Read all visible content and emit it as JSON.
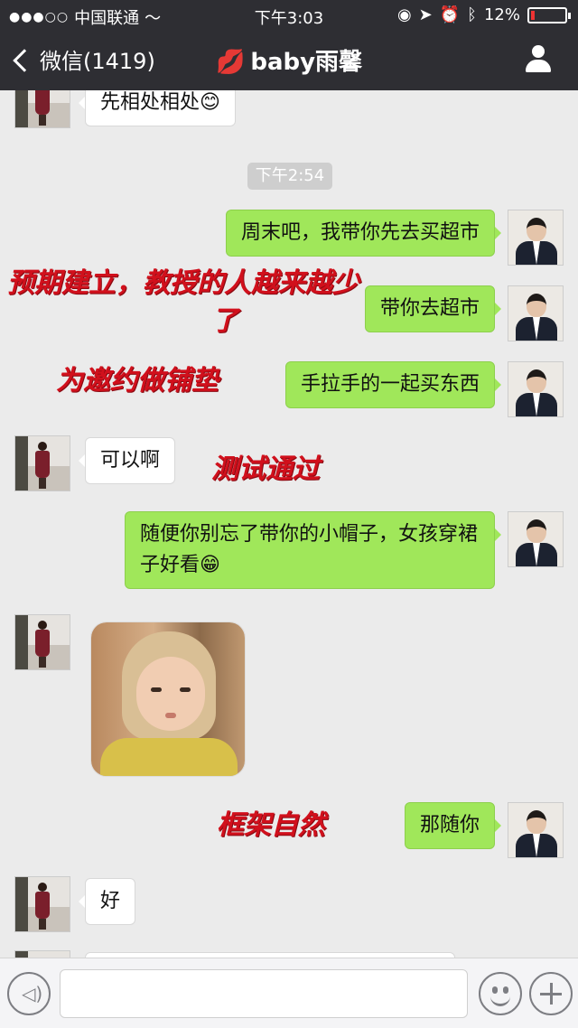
{
  "status_bar": {
    "carrier": "中国联通",
    "signal": "●●●○○",
    "time": "下午3:03",
    "battery": "12%",
    "battery_level": 0.12
  },
  "nav": {
    "back_label": "微信(1419)",
    "title": "baby雨馨",
    "title_icon": "💋"
  },
  "chat": {
    "top_message": "先相处相处😊",
    "timestamp": "下午2:54",
    "messages": [
      {
        "from": "me",
        "text": "周末吧，我带你先去买超市"
      },
      {
        "from": "me",
        "text": "带你去超市"
      },
      {
        "from": "me",
        "text": "手拉手的一起买东西"
      },
      {
        "from": "her",
        "text": "可以啊"
      },
      {
        "from": "me",
        "text": "随便你别忘了带你的小帽子，女孩穿裙子好看😁"
      },
      {
        "from": "her",
        "type": "sticker",
        "icon": "baby-hood-sticker"
      },
      {
        "from": "me",
        "text": "那随你"
      },
      {
        "from": "her",
        "text": "好"
      }
    ]
  },
  "annotations": {
    "a1_line1": "预期建立，教授的人越来越少",
    "a1_line2": "了",
    "a2": "为邀约做铺垫",
    "a3": "测试通过",
    "a4": "框架自然"
  },
  "input_bar": {
    "voice_icon": "voice-icon",
    "emoji_icon": "emoji-icon",
    "plus_icon": "plus-icon"
  }
}
